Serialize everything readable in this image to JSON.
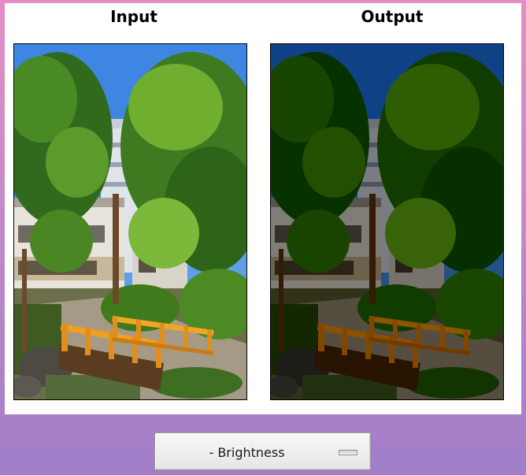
{
  "panels": {
    "input_label": "Input",
    "output_label": "Output"
  },
  "option_menu": {
    "selected": "- Brightness"
  },
  "colors": {
    "background_top": "#e48ec6",
    "background_bottom": "#a07ec8",
    "panel": "#ffffff"
  }
}
